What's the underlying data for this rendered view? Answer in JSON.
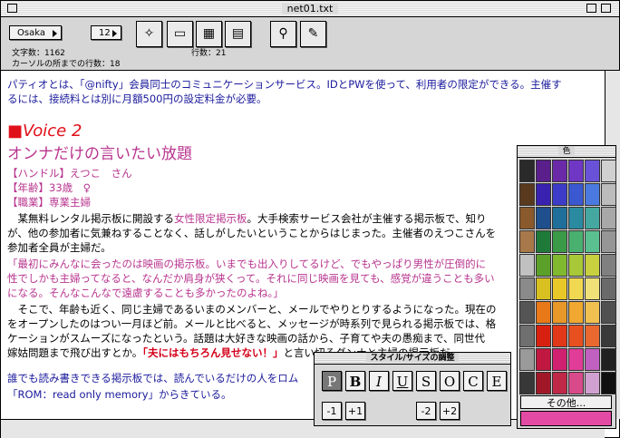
{
  "window": {
    "title": "net01.txt"
  },
  "toolbar": {
    "font_name": "Osaka",
    "font_size": "12",
    "char_count_label": "文字数：1162",
    "lines_label": "行数：21",
    "cursor_line_label": "カーソルの所までの行数：18"
  },
  "content": {
    "intro1": "パティオとは、「@nifty」会員同士のコミュニケーションサービス。IDとPWを使って、利用者の限定ができる。主催す",
    "intro2": "るには、接続料とは別に月額500円の設定料金が必要。",
    "voice_marker": "■",
    "voice_title": "Voice 2",
    "heading": "オンナだけの言いたい放題",
    "handle": "【ハンドル】えつこ　さん",
    "age": "【年齢】33歳　♀",
    "job": "【職業】専業主婦",
    "p1_a": "　某無料レンタル掲示板に開設する",
    "p1_b": "女性限定掲示板",
    "p1_c": "。大手検索サービス会社が主催する掲示板で、知り",
    "p1_line2": "が、他の参加者に気兼ねすることなく、話しがしたいということからはじまった。主催者のえつこさんを",
    "p1_line3": "参加者全員が主婦だ。",
    "q1": "「最初にみんなに会ったのは映画の掲示板。いまでも出入りしてるけど、でもやっぱり男性が圧倒的に",
    "q2": "性でしかも主婦ってなると、なんだか肩身が狭くって。それに同じ映画を見ても、感覚が違うことも多い",
    "q3": "になる。そんなこんなで遠慮することも多かったのよね。」",
    "p2_1": "　そこで、年齢も近く、同じ主婦であるいまのメンバーと、メールでやりとりするようになった。現在の",
    "p2_2": "をオープンしたのはつい一月ほど前。メールと比べると、メッセージが時系列で見られる掲示板では、格",
    "p2_3": "ケーションがスムーズになったという。話題は大好きな映画の話から、子育てや夫の愚痴まで、同世代",
    "p2_4a": "嫁姑問題まで飛び出すとか。",
    "p2_4b": "「夫にはもちろん見せない！」",
    "p2_4c": "と言い切るダンナと主婦の掲示板だ。",
    "p3_1": "誰でも読み書きできる掲示板では、読んでいるだけの人をロム",
    "p3_2": "「ROM：read only memory」からきている。"
  },
  "palette": {
    "title": "色",
    "other_button": "その他...",
    "current_color": "#e24aa4",
    "swatches": [
      "#2a2a2a",
      "#5a1f8a",
      "#6a2aa8",
      "#6f37c4",
      "#6a52d8",
      "#d0d0d0",
      "#5a3a1e",
      "#3a22b0",
      "#3c3cc8",
      "#3a58d0",
      "#4a7ae0",
      "#bcbcbc",
      "#8a5a2c",
      "#1f4f8c",
      "#1f6f9a",
      "#2a8aa0",
      "#45a8a0",
      "#a8a8a8",
      "#a9784a",
      "#1f7a3a",
      "#3a9a48",
      "#4ab070",
      "#5ac090",
      "#969696",
      "#c0c0c0",
      "#5aa02a",
      "#80b830",
      "#a8c838",
      "#c8d040",
      "#808080",
      "#8a8a8a",
      "#d8c020",
      "#e8c828",
      "#f0d850",
      "#f0e078",
      "#6a6a6a",
      "#555555",
      "#e87818",
      "#e89828",
      "#f0a830",
      "#f0c050",
      "#505050",
      "#6f6f6f",
      "#d82010",
      "#e03818",
      "#e85020",
      "#e86830",
      "#3a3a3a",
      "#9a9a9a",
      "#c01840",
      "#d02070",
      "#e03c98",
      "#c060c0",
      "#202020",
      "#383838",
      "#a01828",
      "#c02848",
      "#d84a8a",
      "#d0a0d0",
      "#111111"
    ]
  },
  "style_panel": {
    "title": "スタイル/サイズの調整",
    "buttons": [
      "P",
      "B",
      "I",
      "U",
      "S",
      "O",
      "C",
      "E"
    ],
    "size_buttons": [
      "-1",
      "+1",
      "-2",
      "+2"
    ]
  }
}
